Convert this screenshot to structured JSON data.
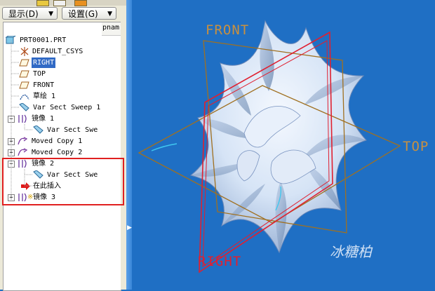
{
  "toolbar": {
    "show_label": "显示",
    "show_accel": "(D)",
    "settings_label": "设置",
    "settings_accel": "(G)"
  },
  "tree_column_header": "pnam",
  "tree": {
    "items": [
      {
        "label": "PRT0001.PRT",
        "icon": "part-icon"
      },
      {
        "label": "DEFAULT_CSYS",
        "icon": "csys-icon"
      },
      {
        "label": "RIGHT",
        "icon": "datum-plane-icon",
        "selected": true
      },
      {
        "label": "TOP",
        "icon": "datum-plane-icon"
      },
      {
        "label": "FRONT",
        "icon": "datum-plane-icon"
      },
      {
        "label": "草绘 1",
        "icon": "sketch-icon"
      },
      {
        "label": "Var Sect Sweep 1",
        "icon": "sweep-icon"
      },
      {
        "label": "镜像 1",
        "icon": "mirror-icon"
      },
      {
        "label": "Var Sect Swe",
        "icon": "sweep-icon"
      },
      {
        "label": "Moved Copy 1",
        "icon": "moved-copy-icon"
      },
      {
        "label": "Moved Copy 2",
        "icon": "moved-copy-icon"
      },
      {
        "label": "镜像 2",
        "icon": "mirror-icon"
      },
      {
        "label": "Var Sect Swe",
        "icon": "sweep-icon"
      },
      {
        "label": "在此插入",
        "icon": "insert-here-arrow-icon"
      },
      {
        "label": "镜像 3",
        "icon": "mirror-icon",
        "suppressed_marker": "※"
      }
    ]
  },
  "viewport": {
    "plane_labels": {
      "front": "FRONT",
      "top": "TOP",
      "right": "RIGHT"
    },
    "watermark": "冰糖柏"
  },
  "colors": {
    "viewport_bg": "#1f6fc4",
    "part_surface": "#dce8f8",
    "datum_front_top": "#9a6a2a",
    "datum_right": "#e02030",
    "highlight_box": "#e02020",
    "selection": "#316ac5"
  }
}
